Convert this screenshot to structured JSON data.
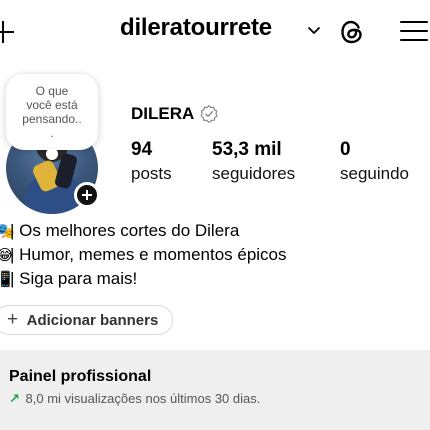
{
  "header": {
    "username": "dileratourrete",
    "icons": [
      "plus-icon",
      "chevron-down-icon",
      "threads-icon",
      "menu-icon"
    ]
  },
  "note": {
    "text": "O que\nvocê está\npensando..\n."
  },
  "profile": {
    "display_name": "DILERA",
    "stats": [
      {
        "value": "94",
        "label": "posts"
      },
      {
        "value": "53,3 mil",
        "label": "seguidores"
      },
      {
        "value": "0",
        "label": "seguindo"
      }
    ]
  },
  "bio": [
    {
      "emoji": "🎭",
      "text": "| Os melhores cortes do Dilera"
    },
    {
      "emoji": "😂",
      "text": "| Humor, memes e momentos épicos"
    },
    {
      "emoji": "📱",
      "text": "| Siga para mais!"
    }
  ],
  "banner_button": {
    "label": "Adicionar banners"
  },
  "pro_panel": {
    "title": "Painel profissional",
    "subtitle": "8,0 mi visualizações nos últimos 30 dias.",
    "trend_color": "#1e9e4f"
  },
  "colors": {
    "panel_bg": "#efefef",
    "border": "#dbdbdb"
  }
}
